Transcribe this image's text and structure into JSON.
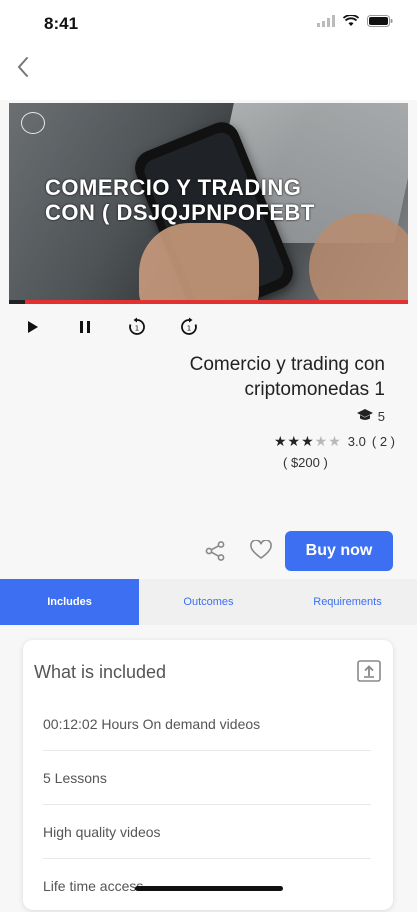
{
  "status": {
    "time": "8:41"
  },
  "video": {
    "overlay_line1": "COMERCIO Y TRADING",
    "overlay_line2": "CON  ( DSJQJPNPOFEBT",
    "progress": 0.04
  },
  "course": {
    "title": "Comercio y trading con criptomonedas 1",
    "lessons": "5",
    "rating": "3.0",
    "rating_count": "( 2 )",
    "stars_filled": 3,
    "stars_total": 5,
    "price": "( $200 )"
  },
  "actions": {
    "buy_label": "Buy now"
  },
  "tabs": [
    {
      "label": "Includes"
    },
    {
      "label": "Outcomes"
    },
    {
      "label": "Requirements"
    }
  ],
  "included": {
    "title": "What is included",
    "items": [
      "00:12:02 Hours On demand videos",
      "5 Lessons",
      "High quality videos",
      "Life time access"
    ]
  },
  "colors": {
    "accent": "#3c6ff2",
    "progress_red": "#e33030"
  }
}
